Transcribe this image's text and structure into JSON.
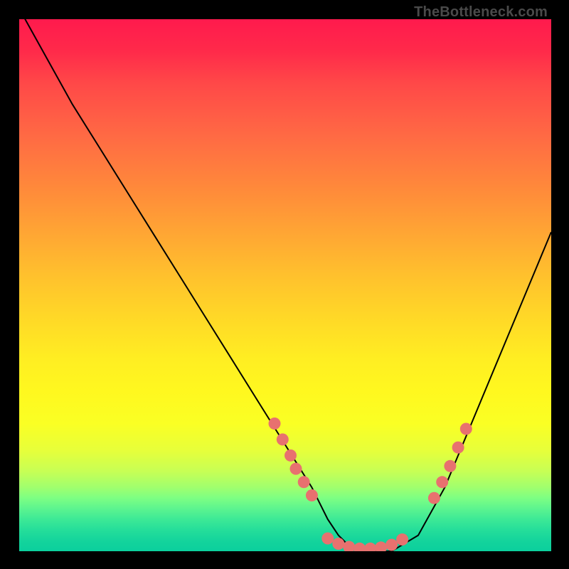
{
  "watermark": "TheBottleneck.com",
  "chart_data": {
    "type": "line",
    "title": "",
    "xlabel": "",
    "ylabel": "",
    "xlim": [
      0,
      100
    ],
    "ylim": [
      0,
      100
    ],
    "series": [
      {
        "name": "curve",
        "x": [
          0,
          5,
          10,
          15,
          20,
          25,
          30,
          35,
          40,
          45,
          50,
          55,
          58,
          60,
          62,
          65,
          70,
          75,
          80,
          85,
          90,
          95,
          100
        ],
        "y": [
          102,
          93,
          84,
          76,
          68,
          60,
          52,
          44,
          36,
          28,
          20,
          12,
          6,
          3,
          1,
          0,
          0,
          3,
          12,
          24,
          36,
          48,
          60
        ]
      }
    ],
    "markers": {
      "left_cluster": {
        "x": [
          48,
          49.5,
          51,
          52,
          53.5,
          55
        ],
        "y": [
          24,
          21,
          18,
          15.5,
          13,
          10.5
        ]
      },
      "bottom_cluster": {
        "x": [
          58,
          60,
          62,
          64,
          66,
          68,
          70,
          72
        ],
        "y": [
          2.4,
          1.4,
          0.8,
          0.5,
          0.5,
          0.7,
          1.2,
          2.2
        ]
      },
      "right_cluster": {
        "x": [
          78,
          79.5,
          81,
          82.5,
          84
        ],
        "y": [
          10,
          13,
          16,
          19.5,
          23
        ]
      }
    },
    "marker_color": "#e8716f",
    "curve_color": "#000000",
    "gradient_stops": [
      {
        "pos": 0,
        "color": "#ff1a4d"
      },
      {
        "pos": 50,
        "color": "#ffd024"
      },
      {
        "pos": 80,
        "color": "#e7ff3a"
      },
      {
        "pos": 100,
        "color": "#0bcf9d"
      }
    ]
  }
}
